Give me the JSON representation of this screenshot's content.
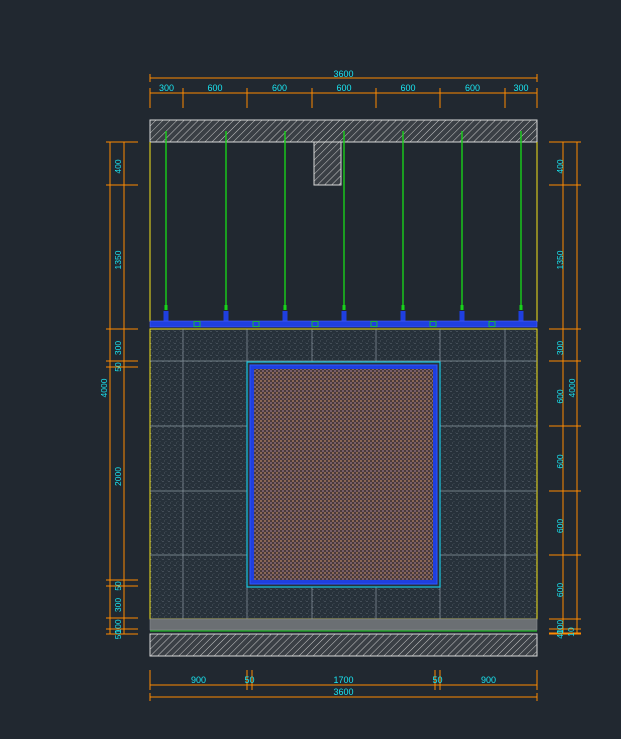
{
  "drawing": {
    "top_dims": [
      "300",
      "600",
      "600",
      "600",
      "600",
      "600",
      "300"
    ],
    "top_total": "3600",
    "bottom_dims": [
      "900",
      "50",
      "1700",
      "50",
      "900"
    ],
    "bottom_total": "3600",
    "left_dims": [
      "400",
      "1350",
      "300",
      "50",
      "2000",
      "50",
      "300",
      "100",
      "50"
    ],
    "left_total": "4000",
    "right_dims": [
      "400",
      "1350",
      "300",
      "600",
      "600",
      "600",
      "600",
      "100",
      "40",
      "10"
    ],
    "right_total": "4000"
  },
  "colors": {
    "background": "#212830",
    "dimension": "#ff8a00",
    "text": "#19e6f2",
    "hanger": "#18d11a",
    "keel": "#1f3fe0",
    "outline": "#f5e31a",
    "frame": "#19c6e0"
  }
}
